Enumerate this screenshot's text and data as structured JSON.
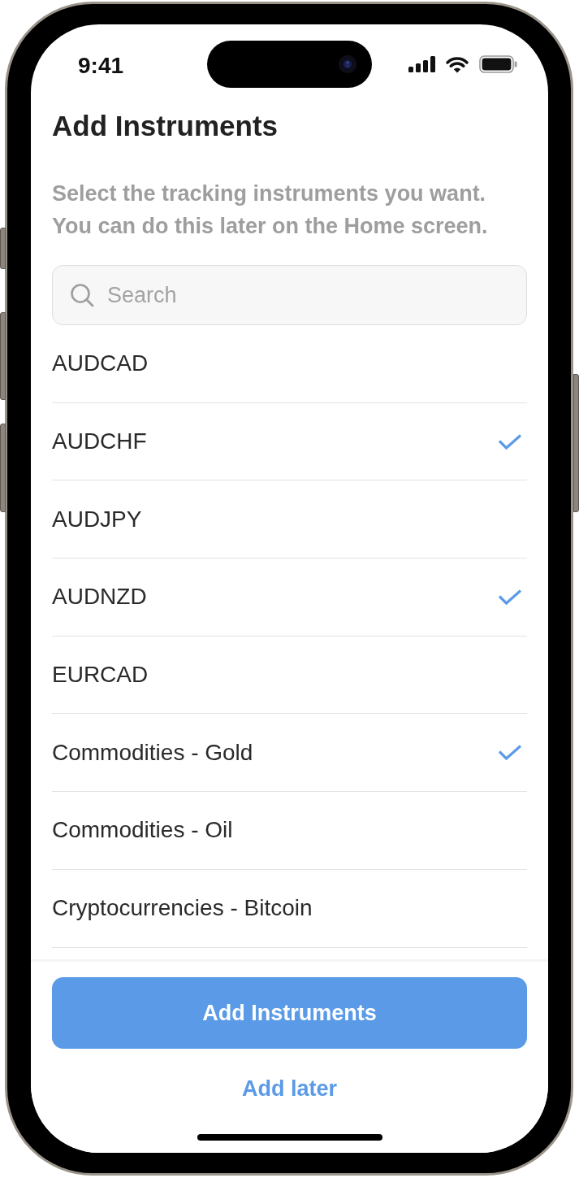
{
  "status_bar": {
    "time": "9:41"
  },
  "header": {
    "title": "Add Instruments",
    "subtitle": "Select the tracking instruments you want. You can do this later on the Home screen."
  },
  "search": {
    "placeholder": "Search"
  },
  "instruments": [
    {
      "name": "AUDCAD",
      "selected": false
    },
    {
      "name": "AUDCHF",
      "selected": true
    },
    {
      "name": "AUDJPY",
      "selected": false
    },
    {
      "name": "AUDNZD",
      "selected": true
    },
    {
      "name": "EURCAD",
      "selected": false
    },
    {
      "name": "Commodities - Gold",
      "selected": true
    },
    {
      "name": "Commodities - Oil",
      "selected": false
    },
    {
      "name": "Cryptocurrencies - Bitcoin",
      "selected": false
    }
  ],
  "actions": {
    "primary": "Add Instruments",
    "secondary": "Add later"
  }
}
